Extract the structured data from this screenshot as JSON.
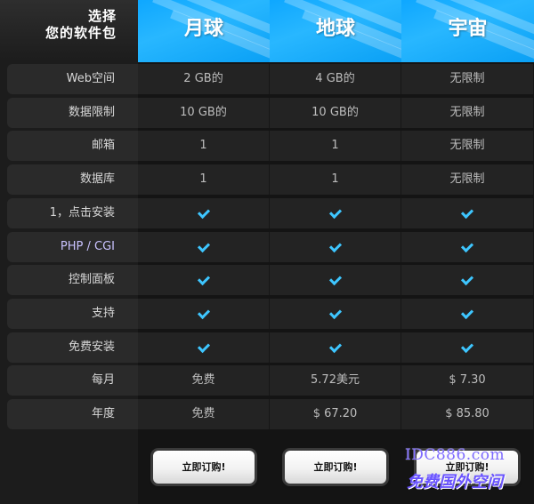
{
  "header": {
    "title_line1": "选择",
    "title_line2": "您的软件包"
  },
  "plans": [
    {
      "name": "月球",
      "order_label": "立即订购!"
    },
    {
      "name": "地球",
      "order_label": "立即订购!"
    },
    {
      "name": "宇宙",
      "order_label": "立即订购!"
    }
  ],
  "features": [
    {
      "label": "Web空间",
      "values": [
        "2 GB的",
        "4 GB的",
        "无限制"
      ]
    },
    {
      "label": "数据限制",
      "values": [
        "10 GB的",
        "10 GB的",
        "无限制"
      ]
    },
    {
      "label": "邮箱",
      "values": [
        "1",
        "1",
        "无限制"
      ]
    },
    {
      "label": "数据库",
      "values": [
        "1",
        "1",
        "无限制"
      ]
    },
    {
      "label": "1，点击安装",
      "values": [
        "check",
        "check",
        "check"
      ]
    },
    {
      "label": "PHP / CGI",
      "values": [
        "check",
        "check",
        "check"
      ]
    },
    {
      "label": "控制面板",
      "values": [
        "check",
        "check",
        "check"
      ]
    },
    {
      "label": "支持",
      "values": [
        "check",
        "check",
        "check"
      ]
    },
    {
      "label": "免费安装",
      "values": [
        "check",
        "check",
        "check"
      ]
    },
    {
      "label": "每月",
      "values": [
        "免费",
        "5.72美元",
        "$ 7.30"
      ]
    },
    {
      "label": "年度",
      "values": [
        "免费",
        "$ 67.20",
        "$ 85.80"
      ]
    }
  ],
  "watermark": {
    "line1": "IDC886.com",
    "line2": "免费国外空间"
  },
  "colors": {
    "accent": "#0ea7ff",
    "check": "#3ec6ff",
    "background": "#1c1c1c"
  }
}
